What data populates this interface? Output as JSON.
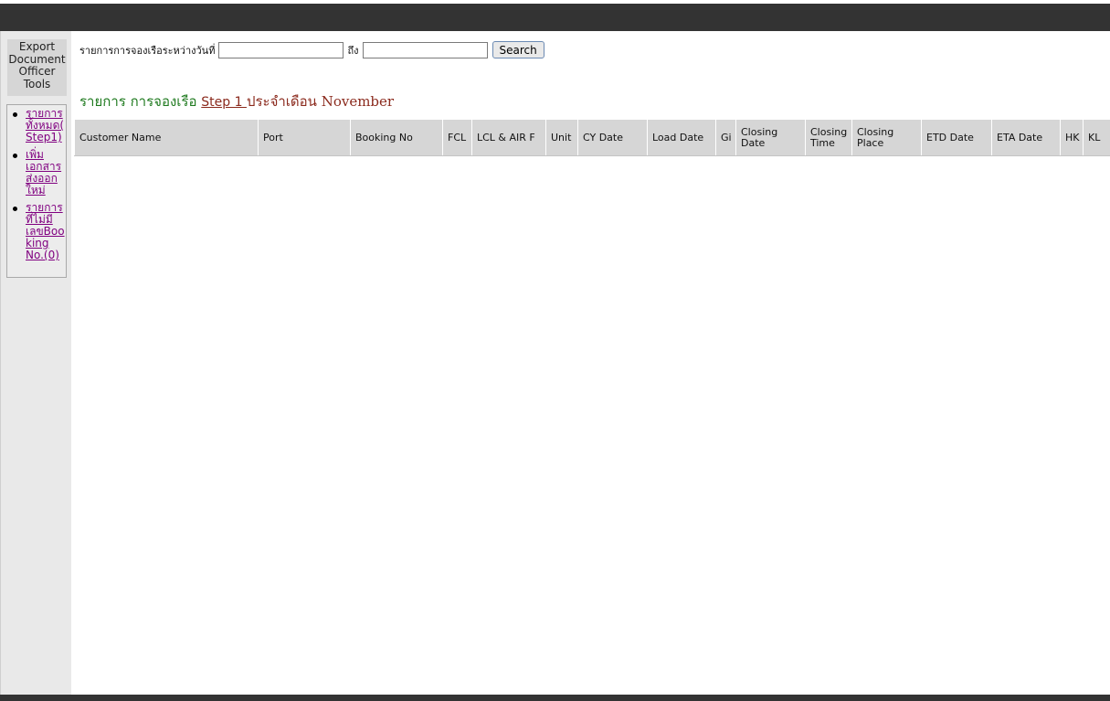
{
  "sidebar": {
    "tools_title": "Export Document Officer Tools",
    "items": [
      {
        "label": "รายการทั้งหมด(Step1)"
      },
      {
        "label": "เพิ่มเอกสารส่งออกใหม่"
      },
      {
        "label": "รายการที่ไม่มีเลขBooking No.(0)"
      }
    ]
  },
  "search": {
    "label": "รายการการจองเรือระหว่างวันที่",
    "to_label": "ถึง",
    "from_value": "",
    "to_value": "",
    "button_label": "Search"
  },
  "heading": {
    "prefix": "รายการ การจองเรือ",
    "link": "Step 1 ",
    "suffix": "ประจำเดือน November"
  },
  "table": {
    "columns": [
      "Customer Name",
      "Port",
      "Booking No",
      "FCL",
      "LCL & AIR F",
      "Unit",
      "CY Date",
      "Load Date",
      "Gi",
      "Closing Date",
      "Closing Time",
      "Closing Place",
      "ETD Date",
      "ETA Date",
      "HK",
      "KL"
    ],
    "rows": []
  },
  "colors": {
    "header_bar": "#333333",
    "heading_green": "#1f7a1f",
    "heading_red": "#8b2a1d",
    "visited_link": "#800080",
    "table_header_bg": "#d6d6d6"
  }
}
